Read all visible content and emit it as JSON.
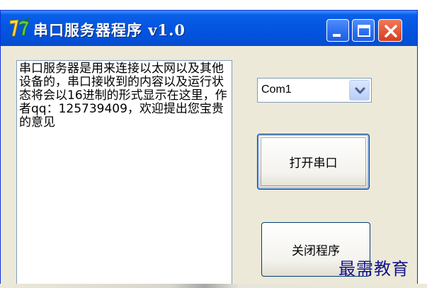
{
  "window": {
    "title": "串口服务器程序  v1.0",
    "buttons": {
      "minimize": "minimize-icon",
      "maximize": "maximize-icon",
      "close": "close-icon"
    }
  },
  "log": {
    "text": "串口服务器是用来连接以太网以及其他设备的，串口接收到的内容以及运行状态将会以16进制的形式显示在这里，作者qq：125739409，欢迎提出您宝贵的意见"
  },
  "port_select": {
    "value": "Com1"
  },
  "buttons": {
    "open_port": "打开串口",
    "close_program": "关闭程序"
  },
  "watermark": "最需教育",
  "colors": {
    "titlebar": "#0355e0",
    "window_bg": "#ece9d8",
    "close_button": "#e25434",
    "watermark": "#14148c"
  }
}
